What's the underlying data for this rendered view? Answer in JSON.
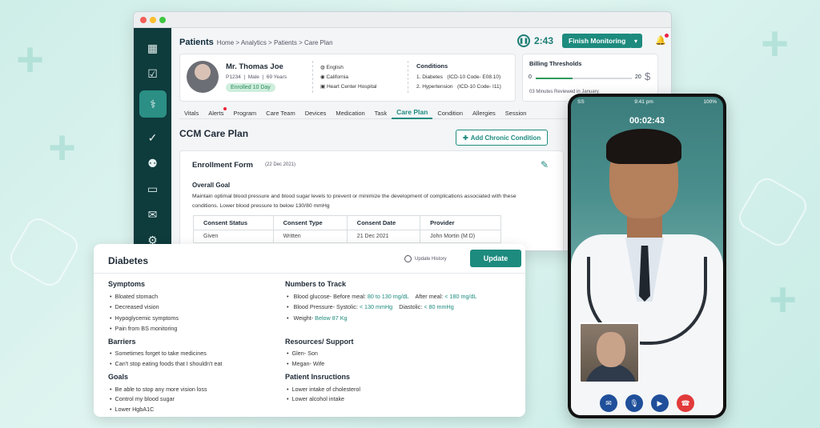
{
  "window": {
    "title": "Patients",
    "breadcrumbs": "Home > Analytics > Patients > Care Plan",
    "timer": "2:43",
    "finish_label": "Finish Monitoring"
  },
  "sidebar": {
    "icons": [
      "grid-icon",
      "calendar-check-icon",
      "doctor-icon",
      "clipboard-icon",
      "medical-staff-icon",
      "billing-icon",
      "chat-icon",
      "settings-icon"
    ]
  },
  "patient": {
    "name": "Mr. Thomas Joe",
    "id": "P1234",
    "sex": "Male",
    "age": "69 Years",
    "enrolled": "Enrolled 10 Day",
    "language": "English",
    "state": "California",
    "hospital": "Heart Center Hospital",
    "conditions_title": "Conditions",
    "conditions": [
      {
        "name": "1. Diabetes",
        "code": "(ICD-10 Code- E08.10)"
      },
      {
        "name": "2. Hypertension",
        "code": "(ICD-10 Code- I11)"
      }
    ]
  },
  "billing": {
    "title": "Billing Thresholds",
    "min": "0",
    "max": "20",
    "currency": "$",
    "progress_fraction": 0.38,
    "reviewed": "03 Minutes Reviewed in January."
  },
  "tabs": [
    "Vitals",
    "Alerts",
    "Program",
    "Care Team",
    "Devices",
    "Medication",
    "Task",
    "Care Plan",
    "Condition",
    "Allergies",
    "Session"
  ],
  "active_tab": "Care Plan",
  "care_plan": {
    "title": "CCM Care Plan",
    "add_button": "Add Chronic Condition"
  },
  "enrollment": {
    "title": "Enrollment Form",
    "date": "(22 Dec 2021)",
    "goal_title": "Overall Goal",
    "goal_text": "Maintain optimal blood pressure and blood sugar levels to prevent or minimize the development of complications associated with these conditions. Lower blood pressure to below 130/80 mmHg",
    "table_headers": [
      "Consent Status",
      "Consent Type",
      "Consent Date",
      "Provider"
    ],
    "table_rows": [
      [
        "Given",
        "Written",
        "21 Dec 2021",
        "John Mortin (M D)"
      ]
    ]
  },
  "diabetes": {
    "title": "Diabetes",
    "update_history": "Update History",
    "update_button": "Update",
    "symptoms_title": "Symptoms",
    "symptoms": [
      "Bloated stomach",
      "Decreased vision",
      "Hypoglycemic symptoms",
      "Pain from BS monitoring"
    ],
    "barriers_title": "Barriers",
    "barriers": [
      "Sometimes forget to take medicines",
      "Can't stop eating foods that I shouldn't eat"
    ],
    "goals_title": "Goals",
    "goals": [
      "Be able to stop any more vision loss",
      "Control my blood sugar",
      "Lower HgbA1C"
    ],
    "numbers_title": "Numbers to Track",
    "glucose_label": "Blood glucose- Before meal:",
    "glucose_before": "80 to 130 mg/dL",
    "glucose_after_label": "After meal:",
    "glucose_after": "< 180 mg/dL",
    "pressure_label": "Blood Pressure- Systolic:",
    "pressure_systolic": "< 130 mmHg",
    "pressure_diastolic_label": "Diastolic:",
    "pressure_diastolic": "< 80 mmHg",
    "weight_label": "Weight-",
    "weight_value": "Below 87 Kg",
    "resources_title": "Resources/ Support",
    "resources": [
      "Glen- Son",
      "Megan- Wife"
    ],
    "instructions_title": "Patient Insructions",
    "instructions": [
      "Lower intake of cholesterol",
      "Lower alcohol intake"
    ]
  },
  "phone": {
    "carrier": "SS",
    "time": "9:41 pm",
    "battery": "100%",
    "call_time": "00:02:43"
  }
}
